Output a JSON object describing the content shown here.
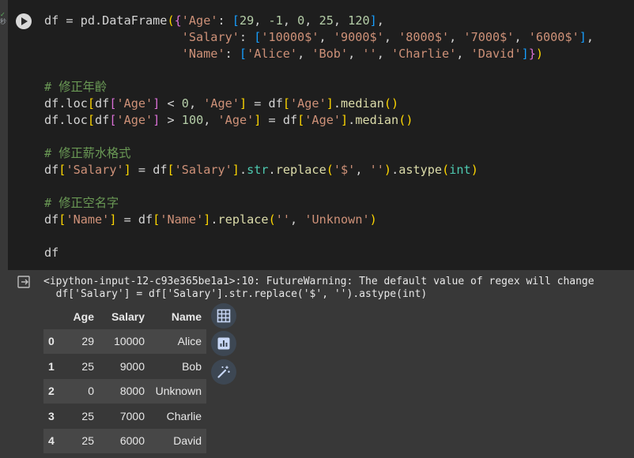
{
  "gutter": {
    "top_mark": "✓",
    "exec_time": "秒"
  },
  "cell": {
    "code_lines": [
      [
        [
          "t",
          "df = pd.DataFrame"
        ],
        [
          "b1",
          "("
        ],
        [
          "b2",
          "{"
        ],
        [
          "s",
          "'Age'"
        ],
        [
          "t",
          ": "
        ],
        [
          "b3",
          "["
        ],
        [
          "n",
          "29"
        ],
        [
          "t",
          ", "
        ],
        [
          "n",
          "-1"
        ],
        [
          "t",
          ", "
        ],
        [
          "n",
          "0"
        ],
        [
          "t",
          ", "
        ],
        [
          "n",
          "25"
        ],
        [
          "t",
          ", "
        ],
        [
          "n",
          "120"
        ],
        [
          "b3",
          "]"
        ],
        [
          "t",
          ","
        ]
      ],
      [
        [
          "t",
          "                   "
        ],
        [
          "s",
          "'Salary'"
        ],
        [
          "t",
          ": "
        ],
        [
          "b3",
          "["
        ],
        [
          "s",
          "'10000$'"
        ],
        [
          "t",
          ", "
        ],
        [
          "s",
          "'9000$'"
        ],
        [
          "t",
          ", "
        ],
        [
          "s",
          "'8000$'"
        ],
        [
          "t",
          ", "
        ],
        [
          "s",
          "'7000$'"
        ],
        [
          "t",
          ", "
        ],
        [
          "s",
          "'6000$'"
        ],
        [
          "b3",
          "]"
        ],
        [
          "t",
          ","
        ]
      ],
      [
        [
          "t",
          "                   "
        ],
        [
          "s",
          "'Name'"
        ],
        [
          "t",
          ": "
        ],
        [
          "b3",
          "["
        ],
        [
          "s",
          "'Alice'"
        ],
        [
          "t",
          ", "
        ],
        [
          "s",
          "'Bob'"
        ],
        [
          "t",
          ", "
        ],
        [
          "s",
          "''"
        ],
        [
          "t",
          ", "
        ],
        [
          "s",
          "'Charlie'"
        ],
        [
          "t",
          ", "
        ],
        [
          "s",
          "'David'"
        ],
        [
          "b3",
          "]"
        ],
        [
          "b2",
          "}"
        ],
        [
          "b1",
          ")"
        ]
      ],
      [],
      [
        [
          "c",
          "# 修正年齡"
        ]
      ],
      [
        [
          "t",
          "df.loc"
        ],
        [
          "b1",
          "["
        ],
        [
          "t",
          "df"
        ],
        [
          "b2",
          "["
        ],
        [
          "s",
          "'Age'"
        ],
        [
          "b2",
          "]"
        ],
        [
          "t",
          " < "
        ],
        [
          "n",
          "0"
        ],
        [
          "t",
          ", "
        ],
        [
          "s",
          "'Age'"
        ],
        [
          "b1",
          "]"
        ],
        [
          "t",
          " = df"
        ],
        [
          "b1",
          "["
        ],
        [
          "s",
          "'Age'"
        ],
        [
          "b1",
          "]"
        ],
        [
          "t",
          "."
        ],
        [
          "f",
          "median"
        ],
        [
          "b1",
          "()"
        ]
      ],
      [
        [
          "t",
          "df.loc"
        ],
        [
          "b1",
          "["
        ],
        [
          "t",
          "df"
        ],
        [
          "b2",
          "["
        ],
        [
          "s",
          "'Age'"
        ],
        [
          "b2",
          "]"
        ],
        [
          "t",
          " > "
        ],
        [
          "n",
          "100"
        ],
        [
          "t",
          ", "
        ],
        [
          "s",
          "'Age'"
        ],
        [
          "b1",
          "]"
        ],
        [
          "t",
          " = df"
        ],
        [
          "b1",
          "["
        ],
        [
          "s",
          "'Age'"
        ],
        [
          "b1",
          "]"
        ],
        [
          "t",
          "."
        ],
        [
          "f",
          "median"
        ],
        [
          "b1",
          "()"
        ]
      ],
      [],
      [
        [
          "c",
          "# 修正薪水格式"
        ]
      ],
      [
        [
          "t",
          "df"
        ],
        [
          "b1",
          "["
        ],
        [
          "s",
          "'Salary'"
        ],
        [
          "b1",
          "]"
        ],
        [
          "t",
          " = df"
        ],
        [
          "b1",
          "["
        ],
        [
          "s",
          "'Salary'"
        ],
        [
          "b1",
          "]"
        ],
        [
          "t",
          "."
        ],
        [
          "a",
          "str"
        ],
        [
          "t",
          "."
        ],
        [
          "f",
          "replace"
        ],
        [
          "b1",
          "("
        ],
        [
          "s",
          "'$'"
        ],
        [
          "t",
          ", "
        ],
        [
          "s",
          "''"
        ],
        [
          "b1",
          ")"
        ],
        [
          "t",
          "."
        ],
        [
          "f",
          "astype"
        ],
        [
          "b1",
          "("
        ],
        [
          "k",
          "int"
        ],
        [
          "b1",
          ")"
        ]
      ],
      [],
      [
        [
          "c",
          "# 修正空名字"
        ]
      ],
      [
        [
          "t",
          "df"
        ],
        [
          "b1",
          "["
        ],
        [
          "s",
          "'Name'"
        ],
        [
          "b1",
          "]"
        ],
        [
          "t",
          " = df"
        ],
        [
          "b1",
          "["
        ],
        [
          "s",
          "'Name'"
        ],
        [
          "b1",
          "]"
        ],
        [
          "t",
          "."
        ],
        [
          "f",
          "replace"
        ],
        [
          "b1",
          "("
        ],
        [
          "s",
          "''"
        ],
        [
          "t",
          ", "
        ],
        [
          "s",
          "'Unknown'"
        ],
        [
          "b1",
          ")"
        ]
      ],
      [],
      [
        [
          "t",
          "df"
        ]
      ]
    ]
  },
  "output": {
    "warning_line1": "<ipython-input-12-c93e365be1a1>:10: FutureWarning: The default value of regex will change",
    "warning_line2": "  df['Salary'] = df['Salary'].str.replace('$', '').astype(int)",
    "table": {
      "columns": [
        "Age",
        "Salary",
        "Name"
      ],
      "rows": [
        {
          "index": "0",
          "values": [
            "29",
            "10000",
            "Alice"
          ]
        },
        {
          "index": "1",
          "values": [
            "25",
            "9000",
            "Bob"
          ]
        },
        {
          "index": "2",
          "values": [
            "0",
            "8000",
            "Unknown"
          ]
        },
        {
          "index": "3",
          "values": [
            "25",
            "7000",
            "Charlie"
          ]
        },
        {
          "index": "4",
          "values": [
            "25",
            "6000",
            "David"
          ]
        }
      ]
    },
    "side_buttons": [
      "table-icon",
      "chart-icon",
      "magic-wand-icon"
    ]
  }
}
